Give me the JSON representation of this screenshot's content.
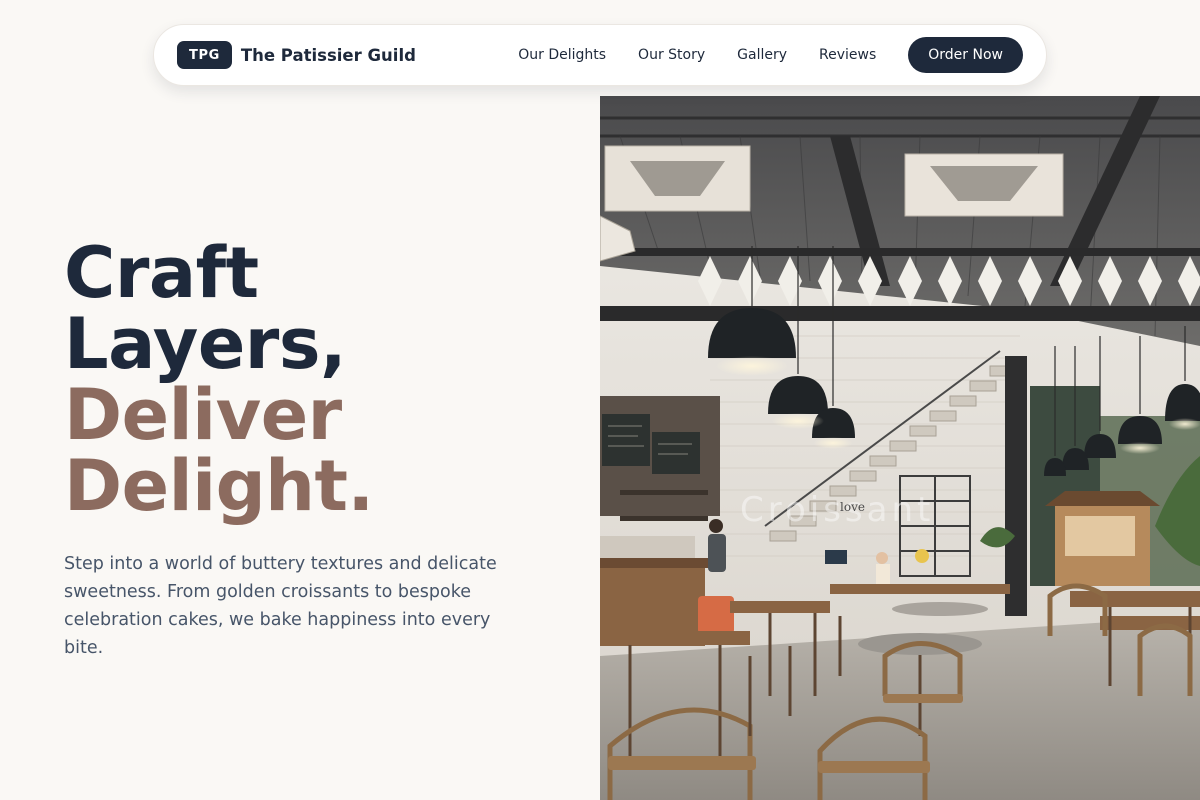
{
  "brand": {
    "badge": "TPG",
    "name": "The Patissier Guild"
  },
  "nav": {
    "links": [
      "Our Delights",
      "Our Story",
      "Gallery",
      "Reviews"
    ],
    "cta": "Order Now"
  },
  "hero": {
    "headline_line1": "Craft",
    "headline_line2": "Layers,",
    "headline_line3": "Deliver",
    "headline_line4": "Delight.",
    "description": "Step into a world of buttery textures and delicate sweetness. From golden croissants to bespoke celebration cakes, we bake happiness into every bite.",
    "image_wall_text": "Croissant",
    "image_sign_text": "love"
  },
  "colors": {
    "primary": "#1e293b",
    "accent": "#8c6b5f",
    "background": "#faf8f5",
    "body_text": "#475569"
  }
}
